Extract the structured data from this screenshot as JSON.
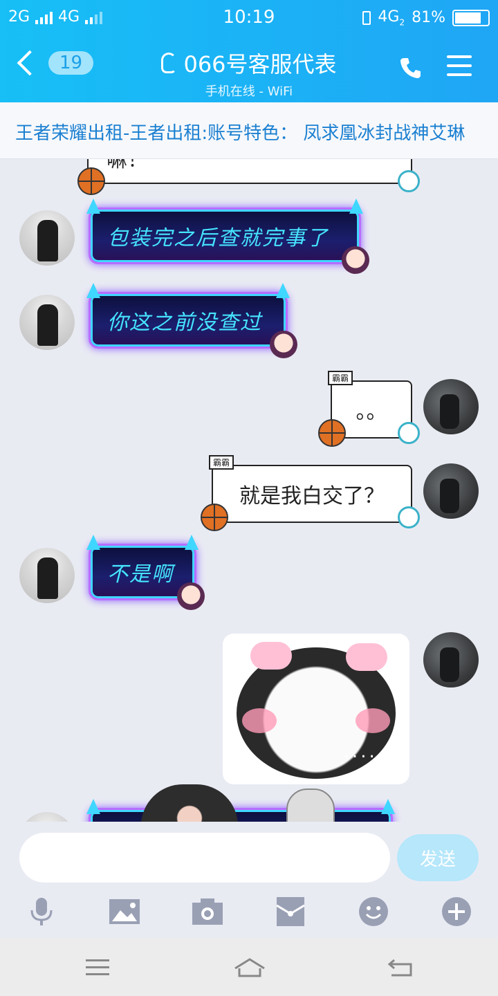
{
  "status_bar": {
    "left_signal_1": "2G",
    "left_signal_2": "4G",
    "time": "10:19",
    "network": "4G",
    "network_sub": "2",
    "battery": "81%",
    "battery_level": 0.81
  },
  "header": {
    "back_count": "19",
    "title": "066号客服代表",
    "subtitle": "手机在线 - WiFi"
  },
  "marquee": {
    "text": "王者荣耀出租-王者出租:账号特色：  凤求凰冰封战神艾琳"
  },
  "messages": [
    {
      "side": "right",
      "type": "text",
      "text": "嘛！",
      "partial": true
    },
    {
      "side": "left",
      "type": "neon",
      "text": "包装完之后查就完事了"
    },
    {
      "side": "left",
      "type": "neon",
      "text": "你这之前没查过"
    },
    {
      "side": "right",
      "type": "text",
      "tag": "霸霸",
      "text": "。。"
    },
    {
      "side": "right",
      "type": "text",
      "tag": "霸霸",
      "text": "就是我白交了？"
    },
    {
      "side": "left",
      "type": "neon",
      "text": "不是啊"
    },
    {
      "side": "right",
      "type": "sticker",
      "text": "....."
    }
  ],
  "input": {
    "placeholder": "",
    "send_label": "发送"
  },
  "toolbar": {
    "icons": [
      "microphone-icon",
      "image-icon",
      "camera-icon",
      "red-packet-icon",
      "emoji-icon",
      "plus-icon"
    ]
  },
  "colors": {
    "header_start": "#17bff6",
    "header_end": "#1fa6f5",
    "marquee_text": "#1a7fd1",
    "neon_text": "#46e4ff",
    "send_button": "#b6e7fb",
    "toolbar_icon": "#9aa0b4"
  }
}
